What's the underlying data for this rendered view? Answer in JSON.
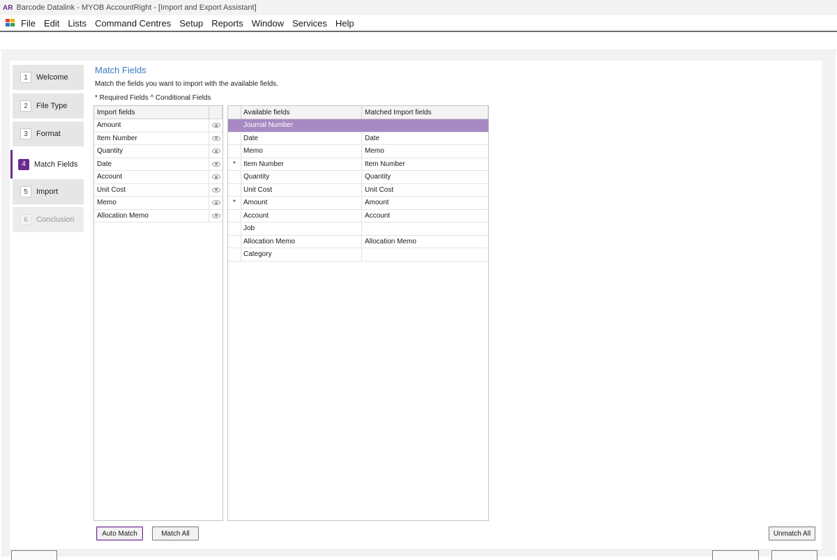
{
  "titlebar": {
    "badge": "AR",
    "title": "Barcode Datalink - MYOB AccountRight - [Import and Export Assistant]"
  },
  "menu": [
    "File",
    "Edit",
    "Lists",
    "Command Centres",
    "Setup",
    "Reports",
    "Window",
    "Services",
    "Help"
  ],
  "steps": [
    {
      "num": "1",
      "label": "Welcome",
      "state": "normal"
    },
    {
      "num": "2",
      "label": "File Type",
      "state": "normal"
    },
    {
      "num": "3",
      "label": "Format",
      "state": "normal"
    },
    {
      "num": "4",
      "label": "Match Fields",
      "state": "active"
    },
    {
      "num": "5",
      "label": "Import",
      "state": "normal"
    },
    {
      "num": "6",
      "label": "Conclusion",
      "state": "disabled"
    }
  ],
  "main": {
    "title": "Match Fields",
    "instructions": "Match the fields you want to import with the available fields.",
    "legend": "* Required Fields  ^ Conditional Fields"
  },
  "import_grid": {
    "header": "Import fields",
    "rows": [
      "Amount",
      "Item Number",
      "Quantity",
      "Date",
      "Account",
      "Unit Cost",
      "Memo",
      "Allocation Memo"
    ]
  },
  "available_grid": {
    "header_available": "Available fields",
    "header_matched": "Matched Import fields",
    "rows": [
      {
        "mark": "",
        "available": "Journal Number",
        "matched": "",
        "selected": true
      },
      {
        "mark": "",
        "available": "Date",
        "matched": "Date"
      },
      {
        "mark": "",
        "available": "Memo",
        "matched": "Memo"
      },
      {
        "mark": "*",
        "available": "Item Number",
        "matched": "Item Number"
      },
      {
        "mark": "",
        "available": "Quantity",
        "matched": "Quantity"
      },
      {
        "mark": "",
        "available": "Unit Cost",
        "matched": "Unit Cost"
      },
      {
        "mark": "*",
        "available": "Amount",
        "matched": "Amount"
      },
      {
        "mark": "",
        "available": "Account",
        "matched": "Account"
      },
      {
        "mark": "",
        "available": "Job",
        "matched": ""
      },
      {
        "mark": "",
        "available": "Allocation Memo",
        "matched": "Allocation Memo"
      },
      {
        "mark": "",
        "available": "Category",
        "matched": ""
      }
    ]
  },
  "buttons": {
    "auto_match": "Auto Match",
    "match_all": "Match All",
    "unmatch_all": "Unmatch All"
  },
  "colors": {
    "accent": "#6b2c8f",
    "selection": "#a88ac3",
    "title_blue": "#3a7bbf"
  }
}
